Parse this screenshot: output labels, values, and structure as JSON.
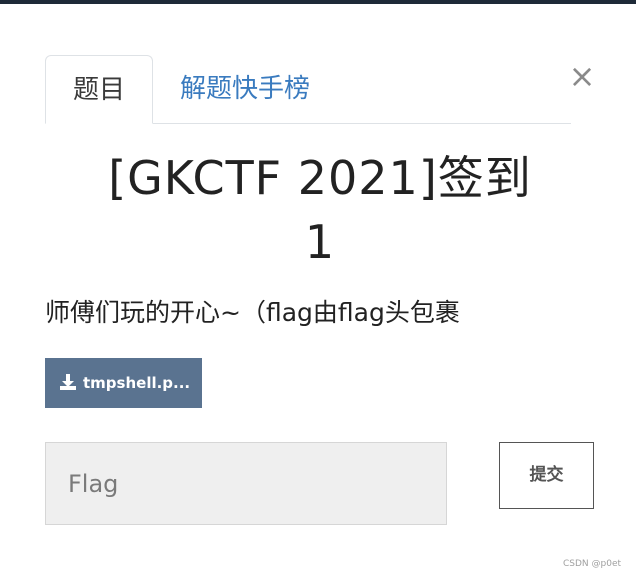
{
  "tabs": [
    {
      "label": "题目",
      "active": true
    },
    {
      "label": "解题快手榜",
      "active": false
    }
  ],
  "close": {
    "glyph": "×"
  },
  "challenge": {
    "title_line1": "[GKCTF 2021]签到",
    "title_line2": "1",
    "description": "师傅们玩的开心~（flag由flag头包裹"
  },
  "download": {
    "label": "tmpshell.p..."
  },
  "flag_input": {
    "placeholder": "Flag",
    "value": ""
  },
  "submit": {
    "label": "提交"
  },
  "watermark": "CSDN @p0et",
  "colors": {
    "download_bg": "#5a7390",
    "tab_link": "#3a7bbf",
    "input_bg": "#efefef"
  },
  "icons": {
    "download": "download-icon",
    "close": "close-icon"
  }
}
